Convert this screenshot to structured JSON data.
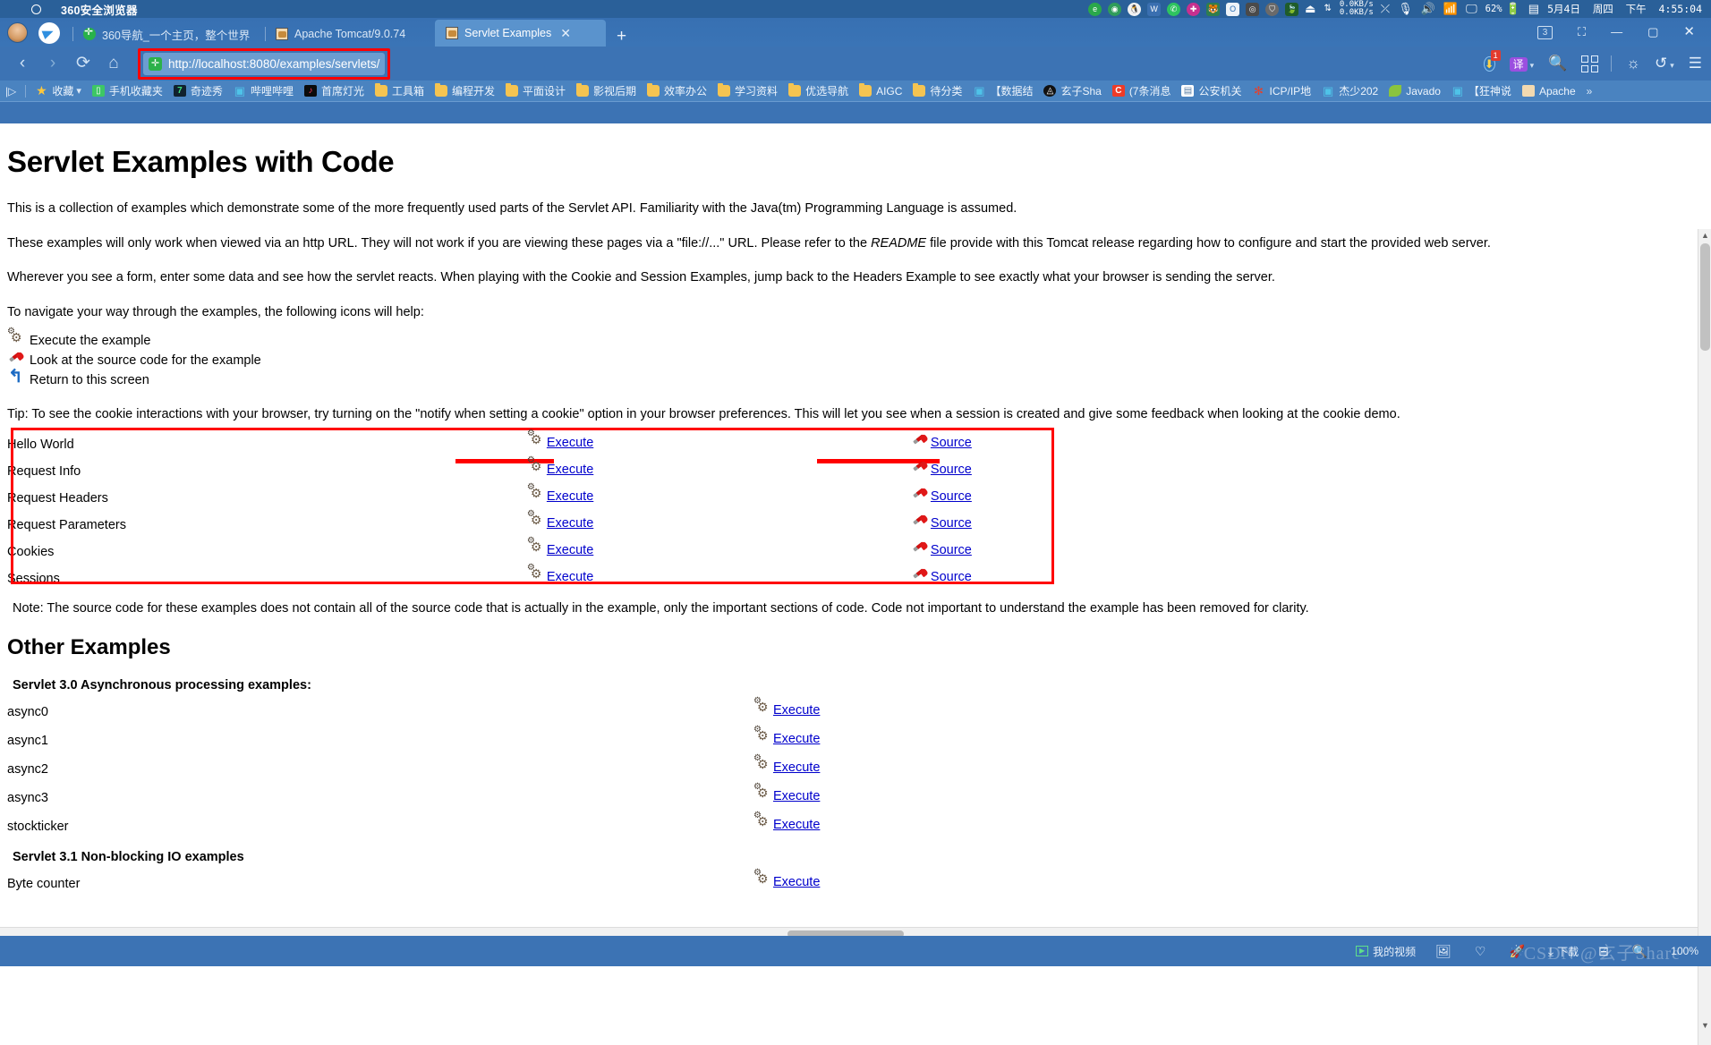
{
  "os": {
    "window_title": "360安全浏览器",
    "tray_icons": [
      "ie-icon",
      "360-safe-icon",
      "qq-penguin-icon",
      "wps-icon",
      "wechat-icon",
      "medical-cross-icon",
      "tiger-icon",
      "outlook-icon",
      "camera-icon",
      "shield-icon",
      "leaf-icon",
      "eject-icon"
    ],
    "network_up": "0.0KB/s",
    "network_down": "0.0KB/s",
    "right_icons": [
      "network-arrows-icon",
      "bluetooth-off-icon",
      "microphone-icon",
      "speaker-icon",
      "wifi-icon",
      "display-icon"
    ],
    "battery_percent": "62%",
    "date": "5月4日",
    "weekday": "周四",
    "meridiem": "下午",
    "time": "4:55:04"
  },
  "browser": {
    "tabs": [
      {
        "label": "360导航_一个主页，整个世界",
        "favicon": "360-green-icon",
        "active": false
      },
      {
        "label": "Apache Tomcat/9.0.74",
        "favicon": "tomcat-cat-icon",
        "active": false
      },
      {
        "label": "Servlet Examples",
        "favicon": "tomcat-cat-icon",
        "active": true
      }
    ],
    "new_tab_label": "+",
    "window_controls": {
      "badge": "3",
      "restore": "⛶",
      "minimize": "—",
      "maximize": "▢",
      "close": "✕"
    },
    "toolbar": {
      "back": "‹",
      "forward": "›",
      "reload": "⟳",
      "home": "⌂",
      "url": "http://localhost:8080/examples/servlets/",
      "url_badge": "✛",
      "url_highlight_color": "#ff0000",
      "right_items": [
        {
          "name": "downloads-icon",
          "badge": "1"
        },
        {
          "name": "translate-icon",
          "label": "译"
        },
        {
          "name": "search-icon"
        },
        {
          "name": "apps-grid-icon"
        },
        {
          "name": "brightness-icon"
        },
        {
          "name": "history-undo-icon"
        },
        {
          "name": "menu-icon"
        }
      ]
    },
    "bookmarks": [
      {
        "label": "收藏",
        "icon": "star-icon",
        "chevron": true
      },
      {
        "label": "手机收藏夹",
        "icon": "phone-green-icon"
      },
      {
        "label": "奇迹秀",
        "icon": "seven-dark-icon"
      },
      {
        "label": "哔哩哔哩",
        "icon": "bilibili-icon"
      },
      {
        "label": "首席灯光",
        "icon": "tiktok-icon"
      },
      {
        "label": "工具箱",
        "icon": "folder-icon"
      },
      {
        "label": "编程开发",
        "icon": "folder-icon"
      },
      {
        "label": "平面设计",
        "icon": "folder-icon"
      },
      {
        "label": "影视后期",
        "icon": "folder-icon"
      },
      {
        "label": "效率办公",
        "icon": "folder-icon"
      },
      {
        "label": "学习资料",
        "icon": "folder-icon"
      },
      {
        "label": "优选导航",
        "icon": "folder-icon"
      },
      {
        "label": "AIGC",
        "icon": "folder-icon"
      },
      {
        "label": "待分类",
        "icon": "folder-icon"
      },
      {
        "label": "【数据结",
        "icon": "bilibili-icon"
      },
      {
        "label": "玄子Sha",
        "icon": "black-circle-icon"
      },
      {
        "label": "(7条消息",
        "icon": "csdn-c-icon"
      },
      {
        "label": "公安机关",
        "icon": "doc-icon"
      },
      {
        "label": "ICP/IP地",
        "icon": "icp-red-icon"
      },
      {
        "label": "杰少202",
        "icon": "bilibili-icon"
      },
      {
        "label": "Javado",
        "icon": "leaf-icon"
      },
      {
        "label": "【狂神说",
        "icon": "bilibili-icon"
      },
      {
        "label": "Apache",
        "icon": "tomcat-cat-icon"
      }
    ],
    "bookmarks_overflow": "»"
  },
  "page": {
    "title": "Servlet Examples with Code",
    "intro_paragraphs": [
      "This is a collection of examples which demonstrate some of the more frequently used parts of the Servlet API. Familiarity with the Java(tm) Programming Language is assumed.",
      "These examples will only work when viewed via an http URL. They will not work if you are viewing these pages via a \"file://...\" URL. Please refer to the README file provide with this Tomcat release regarding how to configure and start the provided web server.",
      "Wherever you see a form, enter some data and see how the servlet reacts. When playing with the Cookie and Session Examples, jump back to the Headers Example to see exactly what your browser is sending the server.",
      "To navigate your way through the examples, the following icons will help:"
    ],
    "readme_word": "README",
    "legend": [
      {
        "icon": "gear-icon",
        "label": "Execute the example"
      },
      {
        "icon": "screwdriver-icon",
        "label": "Look at the source code for the example"
      },
      {
        "icon": "return-arrow-icon",
        "label": "Return to this screen"
      }
    ],
    "tip": "Tip: To see the cookie interactions with your browser, try turning on the \"notify when setting a cookie\" option in your browser preferences. This will let you see when a session is created and give some feedback when looking at the cookie demo.",
    "examples": [
      {
        "name": "Hello World",
        "execute": "Execute",
        "source": "Source"
      },
      {
        "name": "Request Info",
        "execute": "Execute",
        "source": "Source"
      },
      {
        "name": "Request Headers",
        "execute": "Execute",
        "source": "Source"
      },
      {
        "name": "Request Parameters",
        "execute": "Execute",
        "source": "Source"
      },
      {
        "name": "Cookies",
        "execute": "Execute",
        "source": "Source"
      },
      {
        "name": "Sessions",
        "execute": "Execute",
        "source": "Source"
      }
    ],
    "note": "Note: The source code for these examples does not contain all of the source code that is actually in the example, only the important sections of code. Code not important to understand the example has been removed for clarity.",
    "other_title": "Other Examples",
    "async_heading": "Servlet 3.0 Asynchronous processing examples:",
    "async_examples": [
      {
        "name": "async0",
        "execute": "Execute"
      },
      {
        "name": "async1",
        "execute": "Execute"
      },
      {
        "name": "async2",
        "execute": "Execute"
      },
      {
        "name": "async3",
        "execute": "Execute"
      },
      {
        "name": "stockticker",
        "execute": "Execute"
      }
    ],
    "nio_heading": "Servlet 3.1 Non-blocking IO examples",
    "nio_examples": [
      {
        "name": "Byte counter",
        "execute": "Execute"
      }
    ]
  },
  "taskbar": {
    "items": [
      {
        "label": "我的视频",
        "icon": "play-box-icon"
      },
      {
        "label": "",
        "icon": "image-icon"
      },
      {
        "label": "",
        "icon": "heartbeat-icon"
      },
      {
        "label": "",
        "icon": "rocket-icon"
      },
      {
        "label": "下载",
        "icon": "download-icon"
      },
      {
        "label": "",
        "icon": "layout-icon"
      },
      {
        "label": "",
        "icon": "zoom-icon"
      }
    ],
    "zoom_level": "100%",
    "watermark": "CSDN @玄子Share"
  }
}
